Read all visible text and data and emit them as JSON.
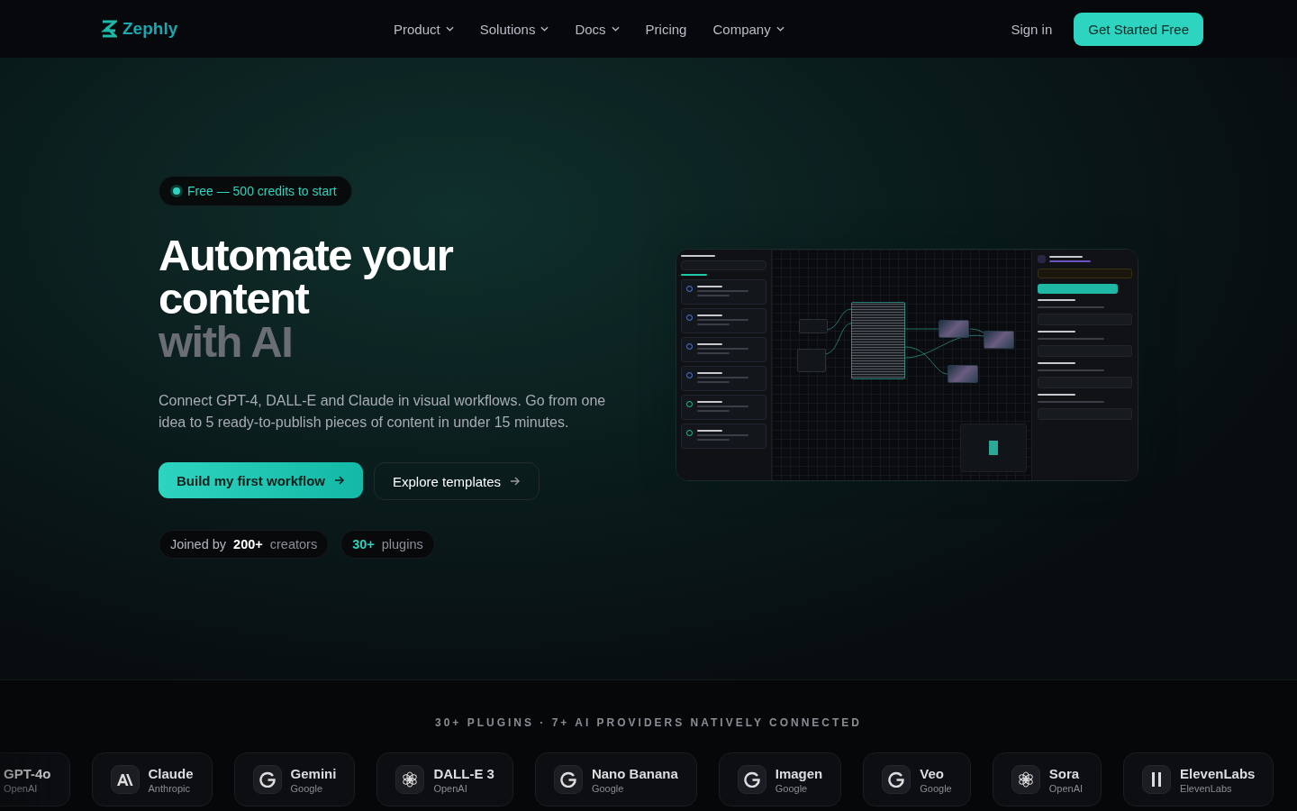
{
  "nav": {
    "logo": "Zephly",
    "links": [
      {
        "label": "Product",
        "dropdown": true
      },
      {
        "label": "Solutions",
        "dropdown": true
      },
      {
        "label": "Docs",
        "dropdown": true
      },
      {
        "label": "Pricing",
        "dropdown": false
      },
      {
        "label": "Company",
        "dropdown": true
      }
    ],
    "sign_in": "Sign in",
    "cta": "Get Started Free"
  },
  "hero": {
    "badge": "Free — 500 credits to start",
    "title_lines": [
      "Automate your",
      "content"
    ],
    "title_accent": "with AI",
    "description": "Connect GPT-4, DALL-E and Claude in visual workflows. Go from one idea to 5 ready-to-publish pieces of content in under 15 minutes.",
    "primary_button": "Build my first workflow",
    "secondary_button": "Explore templates",
    "stats": [
      {
        "kind": "plain",
        "prefix": "Joined by",
        "value": "200+",
        "suffix": "creators"
      },
      {
        "kind": "accent",
        "value": "30+",
        "suffix": "plugins"
      }
    ]
  },
  "providers": {
    "heading": "30+ PLUGINS · 7+ AI PROVIDERS NATIVELY CONNECTED",
    "items": [
      {
        "name": "GPT-4o",
        "vendor": "OpenAI",
        "kind": "openai"
      },
      {
        "name": "Claude",
        "vendor": "Anthropic",
        "kind": "anthropic"
      },
      {
        "name": "Gemini",
        "vendor": "Google",
        "kind": "google"
      },
      {
        "name": "DALL-E 3",
        "vendor": "OpenAI",
        "kind": "openai"
      },
      {
        "name": "Nano Banana",
        "vendor": "Google",
        "kind": "google"
      },
      {
        "name": "Imagen",
        "vendor": "Google",
        "kind": "google"
      },
      {
        "name": "Veo",
        "vendor": "Google",
        "kind": "google"
      },
      {
        "name": "Sora",
        "vendor": "OpenAI",
        "kind": "openai"
      },
      {
        "name": "ElevenLabs",
        "vendor": "ElevenLabs",
        "kind": "elevenlabs"
      }
    ]
  }
}
